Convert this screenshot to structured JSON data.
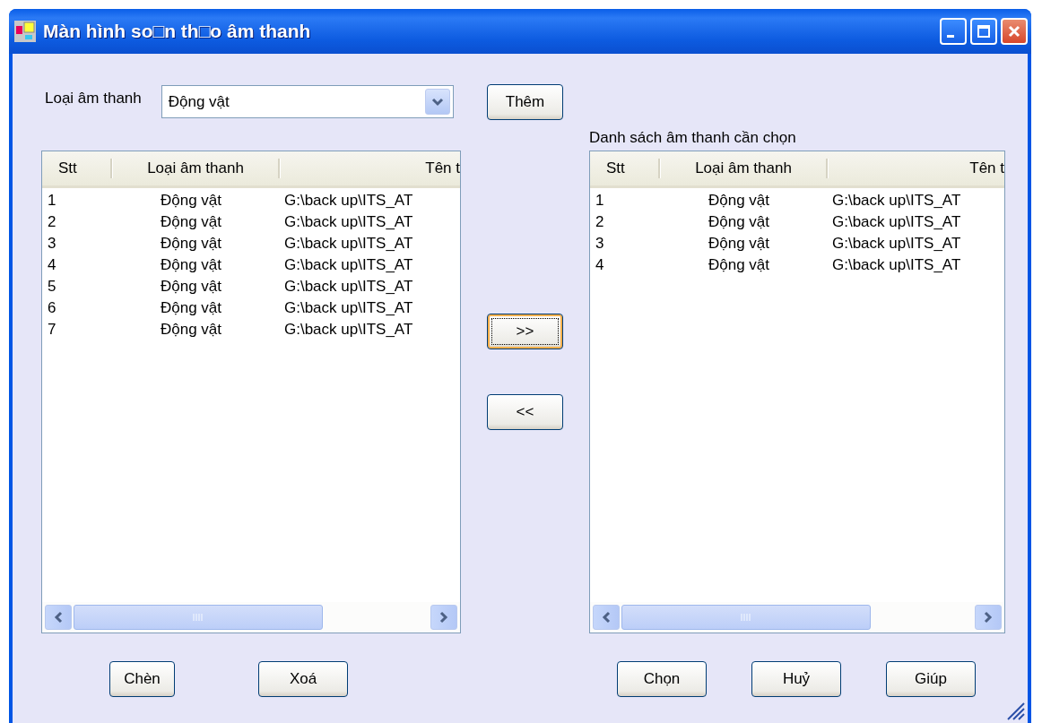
{
  "window": {
    "title": "Màn hình so□n th□o âm thanh"
  },
  "sound_type": {
    "label": "Loại âm thanh",
    "value": "Động vật"
  },
  "add_button": {
    "label": "Thêm",
    "focused": false
  },
  "left_list": {
    "columns": [
      "Stt",
      "Loại âm thanh",
      "Tên t"
    ],
    "rows": [
      {
        "stt": "1",
        "type": "Động vật",
        "file": "G:\\back up\\ITS_AT"
      },
      {
        "stt": "2",
        "type": "Động vật",
        "file": "G:\\back up\\ITS_AT"
      },
      {
        "stt": "3",
        "type": "Động vật",
        "file": "G:\\back up\\ITS_AT"
      },
      {
        "stt": "4",
        "type": "Động vật",
        "file": "G:\\back up\\ITS_AT"
      },
      {
        "stt": "5",
        "type": "Động vật",
        "file": "G:\\back up\\ITS_AT"
      },
      {
        "stt": "6",
        "type": "Động vật",
        "file": "G:\\back up\\ITS_AT"
      },
      {
        "stt": "7",
        "type": "Động vật",
        "file": "G:\\back up\\ITS_AT"
      }
    ]
  },
  "move_buttons": [
    {
      "label": ">>",
      "focused": true
    },
    {
      "label": "<<",
      "focused": false
    }
  ],
  "right_list": {
    "label": "Danh sách âm thanh cần chọn",
    "columns": [
      "Stt",
      "Loại âm thanh",
      "Tên t"
    ],
    "rows": [
      {
        "stt": "1",
        "type": "Động vật",
        "file": "G:\\back up\\ITS_AT"
      },
      {
        "stt": "2",
        "type": "Động vật",
        "file": "G:\\back up\\ITS_AT"
      },
      {
        "stt": "3",
        "type": "Động vật",
        "file": "G:\\back up\\ITS_AT"
      },
      {
        "stt": "4",
        "type": "Động vật",
        "file": "G:\\back up\\ITS_AT"
      }
    ]
  },
  "left_buttons": [
    "Chèn",
    "Xoá"
  ],
  "right_buttons": [
    "Chọn",
    "Huỷ",
    "Giúp"
  ]
}
